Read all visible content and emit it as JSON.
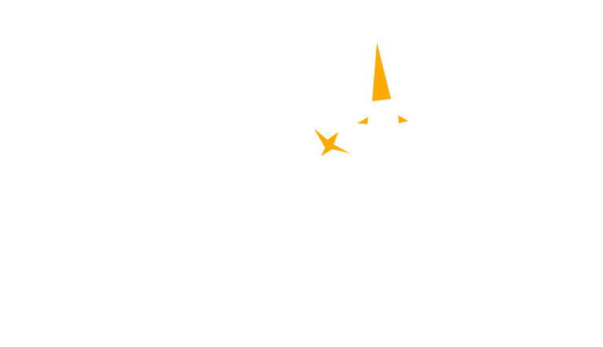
{
  "scene": {
    "background_color": "#ffffff",
    "accent_color": "#ffaa00",
    "shapes": [
      "cone-spike",
      "left-shard",
      "right-shard",
      "starburst"
    ]
  }
}
